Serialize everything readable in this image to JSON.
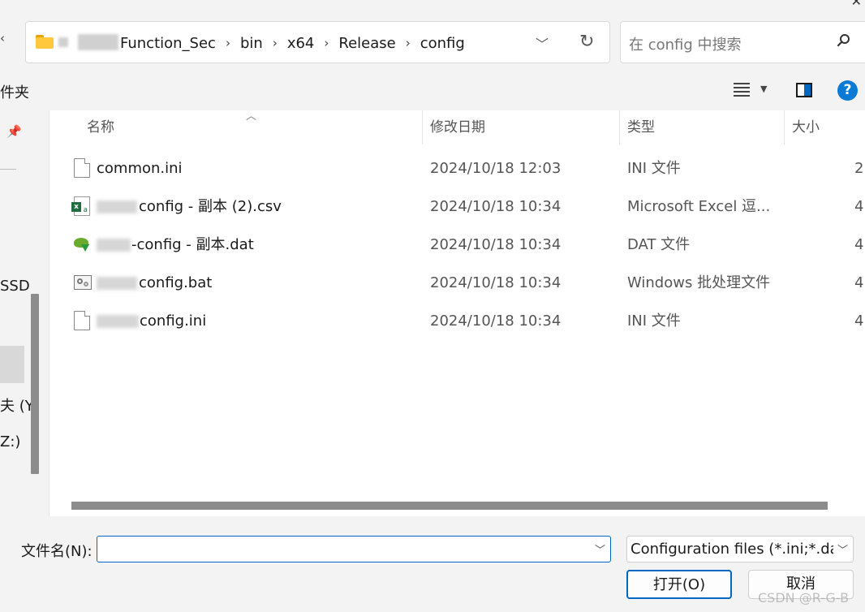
{
  "address": {
    "crumbs": [
      "Function_Sec",
      "bin",
      "x64",
      "Release",
      "config"
    ]
  },
  "search": {
    "placeholder": "在 config 中搜索"
  },
  "command_bar": {
    "new_folder_label": "件夹"
  },
  "nav": {
    "items": [
      "SSD",
      "夫 (Y:",
      "Z:)"
    ]
  },
  "columns": {
    "name": "名称",
    "date": "修改日期",
    "type": "类型",
    "size": "大小"
  },
  "files": [
    {
      "name": "common.ini",
      "date": "2024/10/18 12:03",
      "type": "INI 文件",
      "size": "2",
      "icon": "ini-file-icon"
    },
    {
      "name": "config - 副本 (2).csv",
      "date": "2024/10/18 10:34",
      "type": "Microsoft Excel 逗...",
      "size": "4",
      "icon": "excel-csv-icon"
    },
    {
      "name": "-config - 副本.dat",
      "date": "2024/10/18 10:34",
      "type": "DAT 文件",
      "size": "4",
      "icon": "dat-file-icon"
    },
    {
      "name": "config.bat",
      "date": "2024/10/18 10:34",
      "type": "Windows 批处理文件",
      "size": "4",
      "icon": "bat-file-icon"
    },
    {
      "name": "config.ini",
      "date": "2024/10/18 10:34",
      "type": "INI 文件",
      "size": "4",
      "icon": "ini-file-icon"
    }
  ],
  "bottom": {
    "filename_label": "文件名(N):",
    "filename_value": "",
    "filter_value": "Configuration files (*.ini;*.dat;",
    "open_label": "打开(O)",
    "cancel_label": "取消"
  },
  "watermark": "CSDN @R-G-B"
}
